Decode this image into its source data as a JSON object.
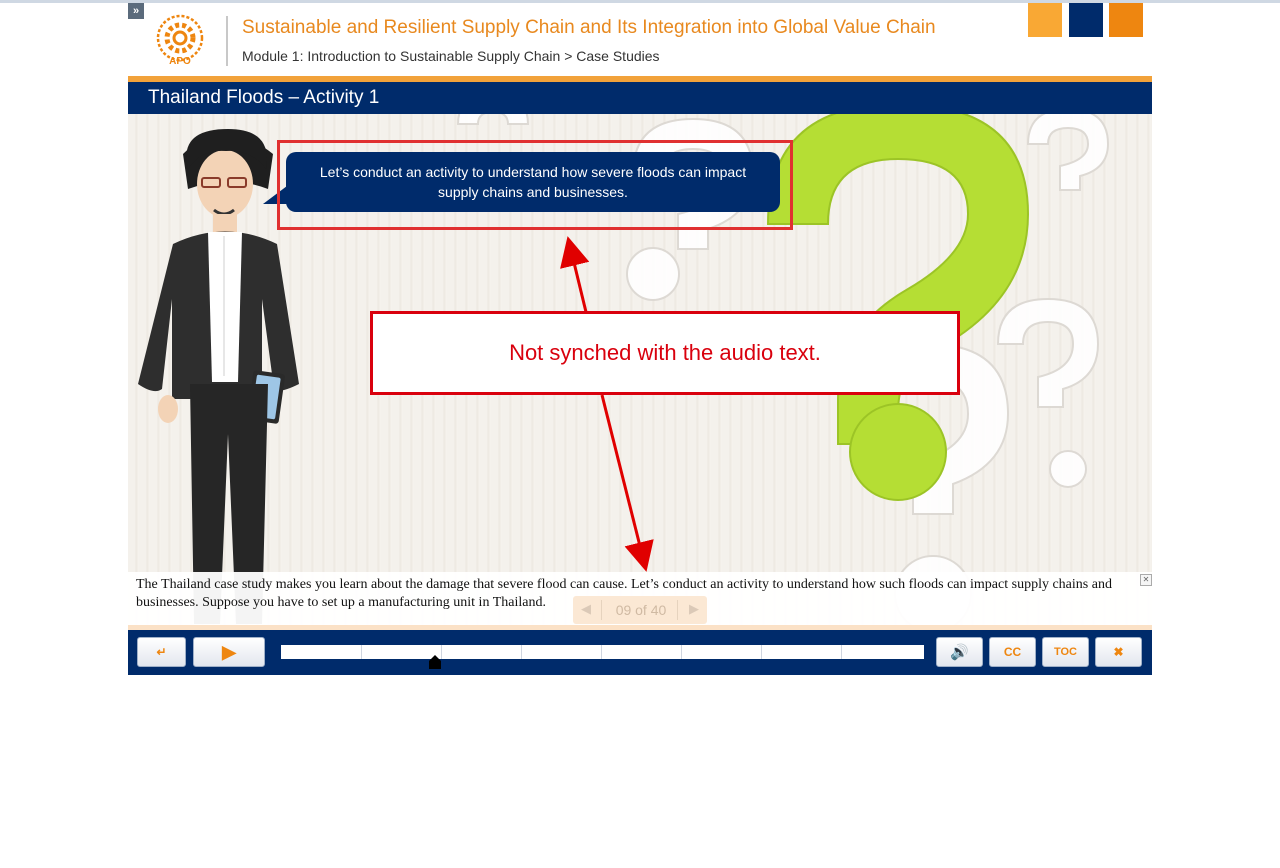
{
  "header": {
    "expand_icon": "double-chevron-right-icon",
    "logo_text": "APO",
    "course_title": "Sustainable and Resilient Supply Chain and Its Integration into Global Value Chain",
    "breadcrumb": "Module 1: Introduction to Sustainable Supply Chain > Case Studies",
    "accent_colors": [
      "#f9a834",
      "#002b6b",
      "#ee8610"
    ]
  },
  "slide": {
    "title": "Thailand Floods – Activity 1",
    "speech_bubble": "Let’s conduct an activity to understand how severe floods can impact supply chains and businesses.",
    "annotation": "Not synched with the audio text."
  },
  "caption": {
    "text": "The Thailand case study makes you learn about the damage that severe flood can cause. Let’s conduct an activity to understand how such floods can impact supply chains and businesses. Suppose you have to set up a manufacturing unit in Thailand.",
    "close_label": "✕"
  },
  "pager": {
    "label": "09 of 40",
    "prev_icon": "◀",
    "next_icon": "▶"
  },
  "controls": {
    "exit_icon": "↵",
    "play_icon": "▶",
    "volume_icon": "🔊",
    "cc_label": "CC",
    "toc_label": "TOC",
    "close_icon": "✖",
    "progress": 0.24
  },
  "colors": {
    "navy": "#002b6b",
    "orange": "#ee8610",
    "annotation_red": "#d9000d",
    "highlight_red": "#e03030",
    "question_green": "#b5de34"
  }
}
